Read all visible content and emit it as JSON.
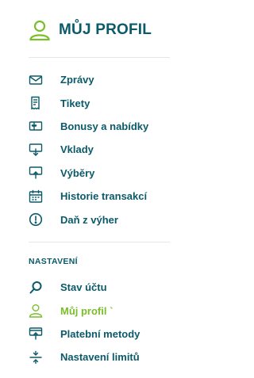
{
  "header": {
    "title": "MŮJ PROFIL",
    "icon": "user-icon"
  },
  "main_menu": [
    {
      "label": "Zprávy",
      "icon": "envelope-icon"
    },
    {
      "label": "Tikety",
      "icon": "ticket-icon"
    },
    {
      "label": "Bonusy a nabídky",
      "icon": "gift-card-icon"
    },
    {
      "label": "Vklady",
      "icon": "deposit-icon"
    },
    {
      "label": "Výběry",
      "icon": "withdrawal-icon"
    },
    {
      "label": "Historie transakcí",
      "icon": "calendar-icon"
    },
    {
      "label": "Daň z výher",
      "icon": "exclamation-icon"
    }
  ],
  "settings": {
    "title": "NASTAVENÍ",
    "items": [
      {
        "label": "Stav účtu",
        "icon": "search-icon"
      },
      {
        "label": "Můj profil `",
        "icon": "user-icon",
        "active": true
      },
      {
        "label": "Platební metody",
        "icon": "payment-method-icon"
      },
      {
        "label": "Nastavení limitů",
        "icon": "limits-icon"
      }
    ]
  },
  "colors": {
    "primary": "#0a5a6a",
    "accent": "#7bbd2a",
    "divider": "#e6e6e6"
  }
}
